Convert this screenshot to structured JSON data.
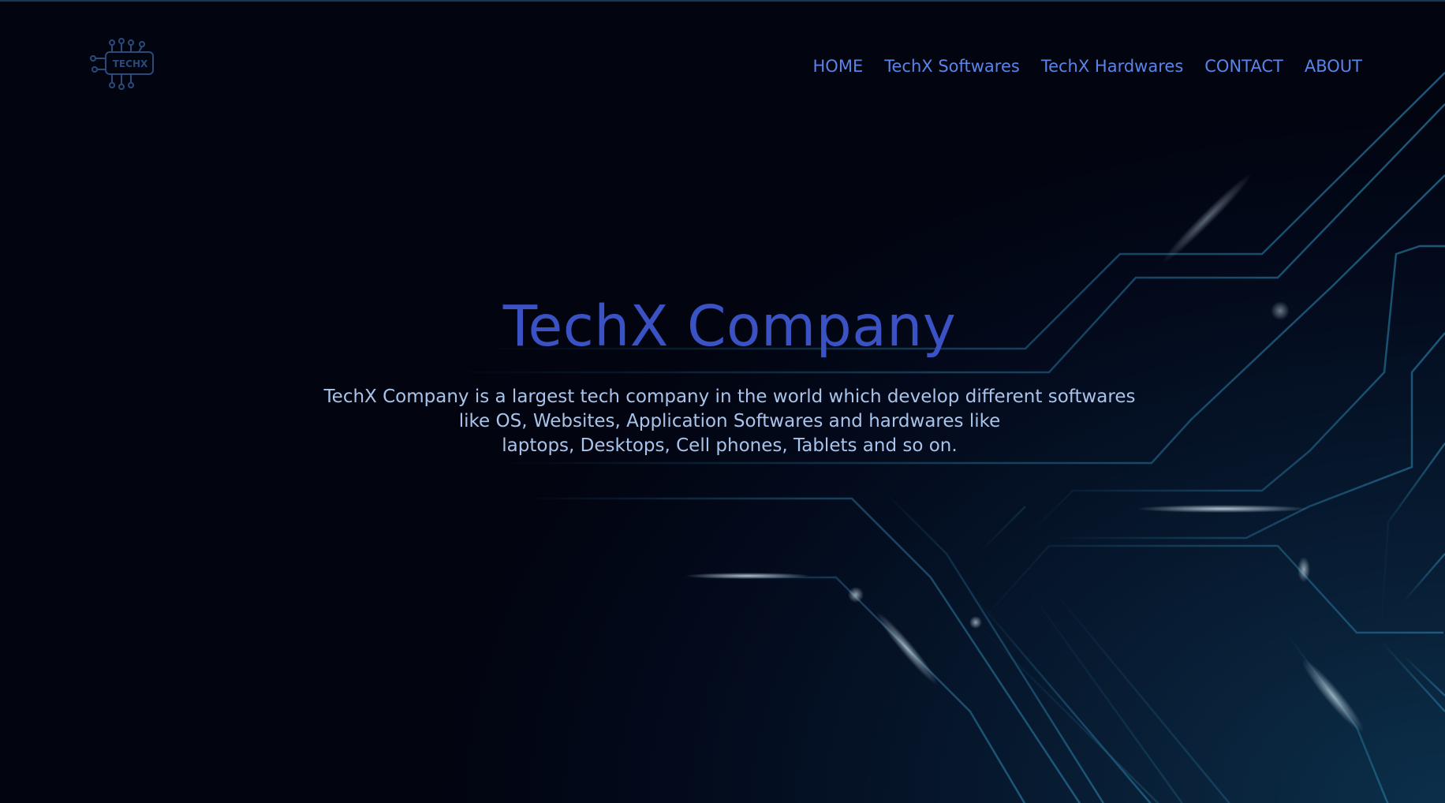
{
  "nav": {
    "logo_text": "TECHX",
    "items": [
      {
        "label": "HOME"
      },
      {
        "label": "TechX Softwares"
      },
      {
        "label": "TechX Hardwares"
      },
      {
        "label": "CONTACT"
      },
      {
        "label": "ABOUT"
      }
    ]
  },
  "hero": {
    "title": "TechX Company",
    "description_lines": [
      "TechX Company is a largest tech company in the world which develop different softwares",
      "like OS, Websites, Application Softwares and hardwares like",
      "laptops, Desktops, Cell phones, Tablets and so on."
    ]
  },
  "colors": {
    "background": "#02040f",
    "nav_link": "#5b84e8",
    "title": "#3a52c4",
    "description": "#a9c4ea",
    "circuit_line": "#1a4f6e"
  },
  "icons": {
    "logo": "circuit-chip-icon"
  }
}
